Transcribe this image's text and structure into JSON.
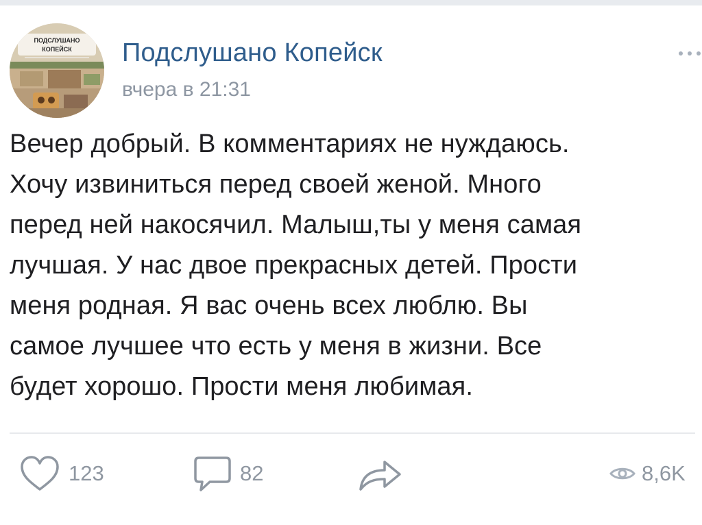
{
  "post": {
    "author": {
      "name": "Подслушано Копейск",
      "avatar_text": {
        "line1": "ПОДСЛУШАНО",
        "line2": "КОПЕЙСК"
      }
    },
    "timestamp": "вчера в 21:31",
    "text": "Вечер добрый. В комментариях не нуждаюсь.\nХочу извиниться перед своей женой. Много\nперед ней накосячил. Малыш,ты у меня самая\nлучшая. У нас двое прекрасных детей. Прости\nменя родная. Я вас очень всех люблю.  Вы\nсамое лучшее что есть у меня в жизни. Все\nбудет хорошо. Прости меня любимая."
  },
  "actions": {
    "likes": "123",
    "comments": "82",
    "views": "8,6K"
  },
  "icons": {
    "more": "more-horizontal-icon",
    "like": "heart-outline-icon",
    "comment": "speech-bubble-icon",
    "share": "share-arrow-icon",
    "views": "eye-icon"
  },
  "colors": {
    "author": "#2f5d8c",
    "secondary_text": "#8d96a2",
    "action_icons": "#8f97a1",
    "divider": "#e7e9ec"
  }
}
